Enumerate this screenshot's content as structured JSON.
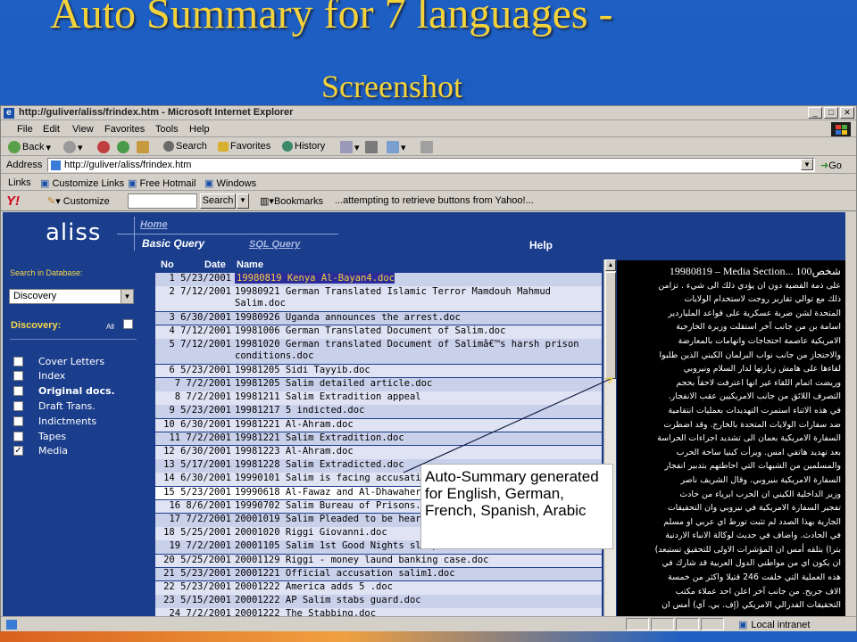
{
  "slide": {
    "title_line1": "Auto Summary for 7 languages -",
    "title_line2": "Screenshot"
  },
  "browser": {
    "window_title": "http://guliver/aliss/frindex.htm - Microsoft Internet Explorer",
    "menu": [
      "File",
      "Edit",
      "View",
      "Favorites",
      "Tools",
      "Help"
    ],
    "toolbar": {
      "back": "Back",
      "search": "Search",
      "favorites": "Favorites",
      "history": "History"
    },
    "address_label": "Address",
    "address_value": "http://guliver/aliss/frindex.htm",
    "go_label": "Go",
    "links": {
      "label": "Links",
      "items": [
        "Customize Links",
        "Free Hotmail",
        "Windows"
      ]
    },
    "yahoo": {
      "logo": "Y!",
      "customize": "Customize",
      "search_button": "Search",
      "bookmarks": "Bookmarks",
      "status": "...attempting to retrieve buttons from Yahoo!..."
    },
    "status_zone": "Local intranet"
  },
  "app": {
    "logo": "aliss",
    "nav": {
      "home": "Home",
      "basic_query": "Basic Query",
      "sql_query": "SQL Query",
      "help": "Help"
    },
    "sidebar": {
      "search_label": "Search in Database:",
      "database_value": "Discovery",
      "discovery_label": "Discovery:",
      "all_label": "All",
      "categories": [
        {
          "label": "Cover Letters",
          "checked": false,
          "bold": false
        },
        {
          "label": "Index",
          "checked": false,
          "bold": false
        },
        {
          "label": "Original docs.",
          "checked": false,
          "bold": true
        },
        {
          "label": "Draft Trans.",
          "checked": false,
          "bold": false
        },
        {
          "label": "Indictments",
          "checked": false,
          "bold": false
        },
        {
          "label": "Tapes",
          "checked": false,
          "bold": false
        },
        {
          "label": "Media",
          "checked": true,
          "bold": false
        }
      ]
    },
    "results": {
      "columns": [
        "No",
        "Date",
        "Name"
      ],
      "rows": [
        {
          "no": "1",
          "date": "5/23/2001",
          "name": "19980819 Kenya Al-Bayan4.doc",
          "selected": true
        },
        {
          "no": "2",
          "date": "7/12/2001",
          "name": "19980921 German Translated Islamic Terror Mamdouh Mahmud Salim.doc"
        },
        {
          "no": "3",
          "date": "6/30/2001",
          "name": "19980926 Uganda announces the arrest.doc"
        },
        {
          "no": "4",
          "date": "7/12/2001",
          "name": "19981006 German Translated Document of Salim.doc"
        },
        {
          "no": "5",
          "date": "7/12/2001",
          "name": "19981020 German translated Document of Salimâ€™s harsh prison conditions.doc"
        },
        {
          "no": "6",
          "date": "5/23/2001",
          "name": "19981205 Sidi Tayyib.doc"
        },
        {
          "no": "7",
          "date": "7/2/2001",
          "name": "19981205 Salim detailed article.doc"
        },
        {
          "no": "8",
          "date": "7/2/2001",
          "name": "19981211 Salim Extradition appeal"
        },
        {
          "no": "9",
          "date": "5/23/2001",
          "name": "19981217 5 indicted.doc"
        },
        {
          "no": "10",
          "date": "6/30/2001",
          "name": "19981221 Al-Ahram.doc"
        },
        {
          "no": "11",
          "date": "7/2/2001",
          "name": "19981221 Salim Extradition.doc"
        },
        {
          "no": "12",
          "date": "6/30/2001",
          "name": "19981223 Al-Ahram.doc"
        },
        {
          "no": "13",
          "date": "5/17/2001",
          "name": "19981228 Salim Extradicted.doc"
        },
        {
          "no": "14",
          "date": "6/30/2001",
          "name": "19990101 Salim is facing accusations.doc"
        },
        {
          "no": "15",
          "date": "5/23/2001",
          "name": "19990618 Al-Fawaz and Al-Dhawaheri Al-Bayan5.doc"
        },
        {
          "no": "16",
          "date": "8/6/2001",
          "name": "19990702 Salim Bureau of Prisons.doc"
        },
        {
          "no": "17",
          "date": "7/2/2001",
          "name": "20001019 Salim Pleaded to be heard.doc"
        },
        {
          "no": "18",
          "date": "5/25/2001",
          "name": "20001020 Riggi Giovanni.doc"
        },
        {
          "no": "19",
          "date": "7/2/2001",
          "name": "20001105 Salim 1st Good Nights sleep.doc"
        },
        {
          "no": "20",
          "date": "5/25/2001",
          "name": "20001129 Riggi - money laund banking case.doc"
        },
        {
          "no": "21",
          "date": "5/23/2001",
          "name": "20001221 Official accusation salim1.doc"
        },
        {
          "no": "22",
          "date": "5/23/2001",
          "name": "20001222 America adds 5 .doc"
        },
        {
          "no": "23",
          "date": "5/15/2001",
          "name": "20001222 AP Salim stabs guard.doc"
        },
        {
          "no": "24",
          "date": "7/2/2001",
          "name": "20001222 The Stabbing.doc"
        }
      ]
    },
    "callout": "Auto-Summary generated for English, German, French, Spanish, Arabic",
    "summary": {
      "first_line": "19980819 – Media Section... 100شخص",
      "lines": [
        "على ذمة القضية دون ان يؤدي ذلك الى شيء . تزامن",
        "ذلك مع توالي تقارير روجت لاستخدام الولايات",
        "المتحدة لشن ضربة عسكرية على قواعد الملياردير",
        "اسامة بن من جانب آخر استقلت وزيرة الخارجية",
        "الامريكية عاصمة احتجاجات واتهامات بالمعارضة",
        "والاحتجاز من جانب نواب البرلمان الكيني الذين طلبوا",
        "لقاءها على هامش زيارتها لدار السلام ونيروبي",
        "وريضت اتمام اللقاء غير انها اعترفت لاحقاً بحجم",
        "التصرف اللائق من جانب الامريكيين عقب الانفجار.",
        "في هذه الاثناء استمرت التهديدات بعمليات انتقامية",
        "ضد سفارات الولايات المتحدة بالخارج. وقد اضطرت",
        "السفارة الامريكية بعمان الى تشديد اجراءات الحراسة",
        "بعد تهديد هاتفي امس. ويرأت كينيا ساحة الحرب",
        "والمسلمين من الشبهات التي احاطتهم بتدبير انفجار",
        "السفارة الامريكية بنيروبي. وقال الشريف ناصر",
        "وزير الداخلية الكيني ان الحرب ابرياء من حادث",
        "تفجير السفارة الامريكية في نيروبي وان التحقيقات",
        "الجارية بهذا الصدد لم تثبت تورط اي عربي او مسلم",
        "في الحادث. واضاف في حديث لوكالة الانباء الاردنية",
        "بترا) بتلقه أمس ان المؤشرات الاولى للتحقيق تستبعد)",
        "ان يكون اي من مواطني الدول العربية قد شارك في",
        "هذه العملية التي خلفت 246 قتيلا واكثر من خمسة",
        "الاف جريح. من جانب آخر اعلن احد عملاء مكتب",
        "التحقيقات الفدرالي الامريكي (إف. بي. آي) أمس ان"
      ]
    }
  }
}
